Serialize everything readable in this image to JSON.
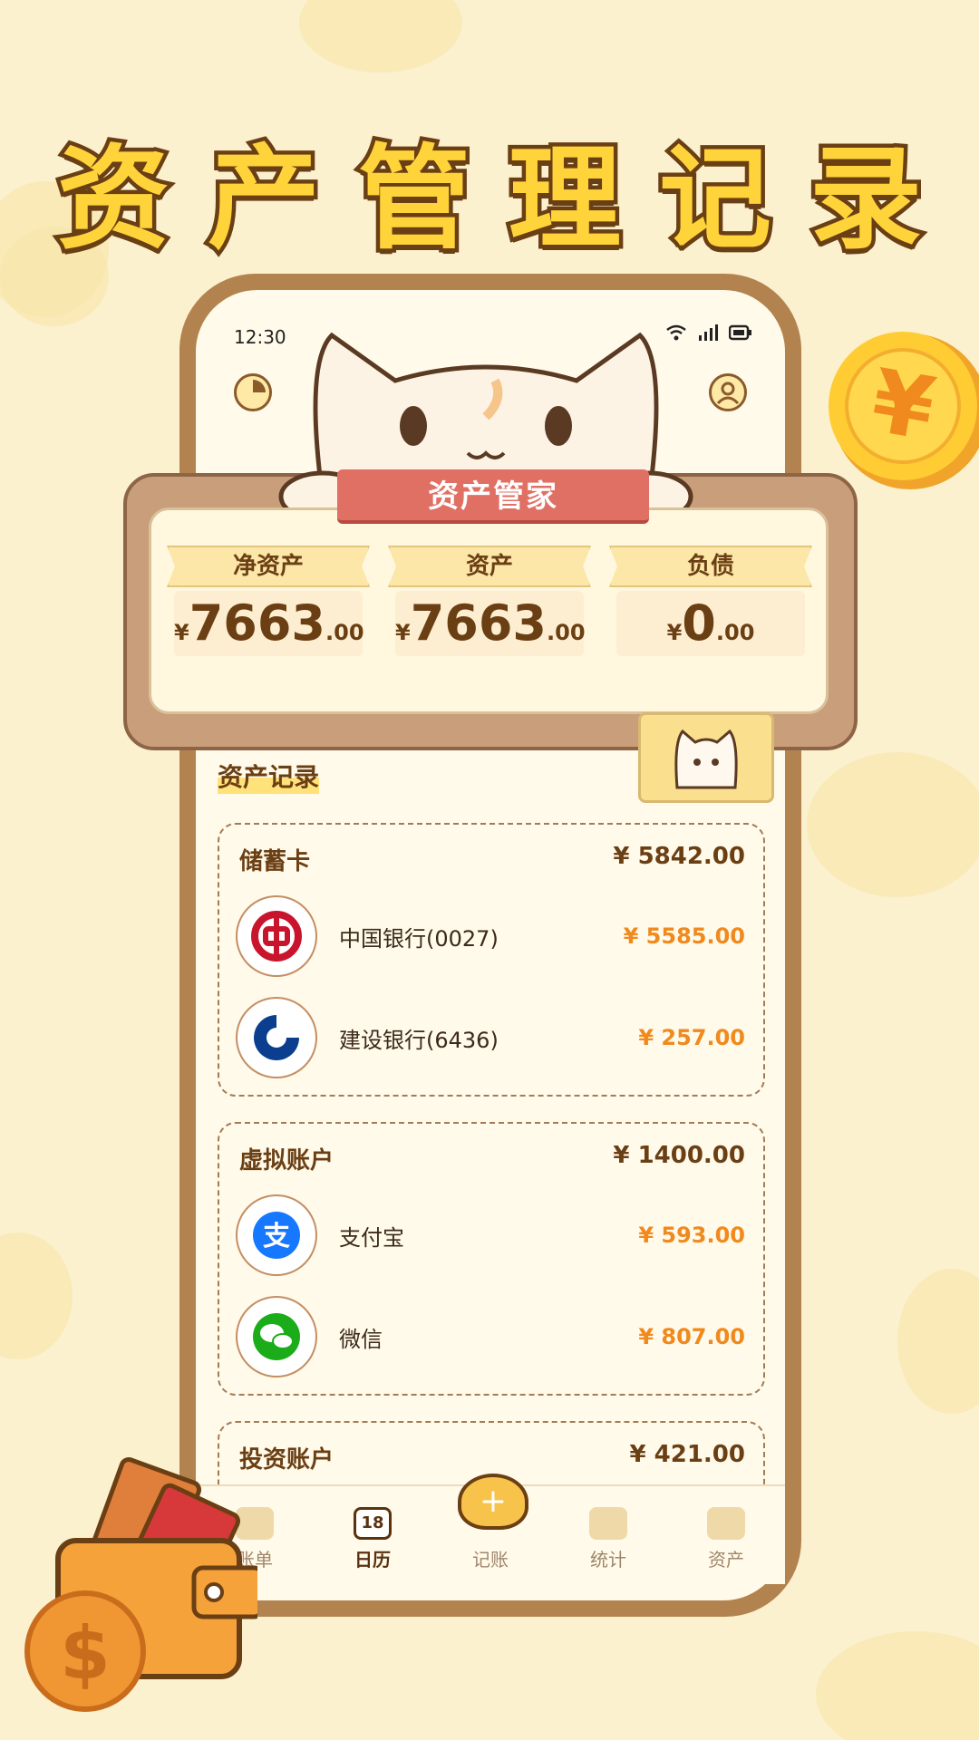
{
  "headline": "资产管理记录",
  "status": {
    "time": "12:30"
  },
  "board": {
    "ribbon": "资产管家",
    "stats": [
      {
        "label": "净资产",
        "currency": "¥",
        "integer": "7663",
        "decimal": ".00"
      },
      {
        "label": "资产",
        "currency": "¥",
        "integer": "7663",
        "decimal": ".00"
      },
      {
        "label": "负债",
        "currency": "¥",
        "integer": "0",
        "decimal": ".00"
      }
    ]
  },
  "records": {
    "title": "资产记录",
    "groups": [
      {
        "name": "储蓄卡",
        "total": "¥ 5842.00",
        "accounts": [
          {
            "name": "中国银行(0027)",
            "amount": "¥ 5585.00",
            "icon": "bank-of-china-icon",
            "color": "#c8152d"
          },
          {
            "name": "建设银行(6436)",
            "amount": "¥ 257.00",
            "icon": "ccb-icon",
            "color": "#0b3e8f"
          }
        ]
      },
      {
        "name": "虚拟账户",
        "total": "¥ 1400.00",
        "accounts": [
          {
            "name": "支付宝",
            "amount": "¥ 593.00",
            "icon": "alipay-icon",
            "color": "#1677ff"
          },
          {
            "name": "微信",
            "amount": "¥ 807.00",
            "icon": "wechat-icon",
            "color": "#1aad19"
          }
        ]
      },
      {
        "name": "投资账户",
        "total": "¥ 421.00",
        "accounts": []
      }
    ]
  },
  "tabs": [
    {
      "label": "账单",
      "icon": "tag-icon"
    },
    {
      "label": "日历",
      "icon": "calendar-icon",
      "badge": "18"
    },
    {
      "label": "记账",
      "icon": "cat-add-icon"
    },
    {
      "label": "统计",
      "icon": "coins-icon"
    },
    {
      "label": "资产",
      "icon": "wallet-icon"
    }
  ],
  "colors": {
    "background": "#fbf1cf",
    "frame": "#b3834f",
    "accent": "#f08a1e",
    "text": "#6b3f14",
    "ribbon": "#e07064"
  }
}
